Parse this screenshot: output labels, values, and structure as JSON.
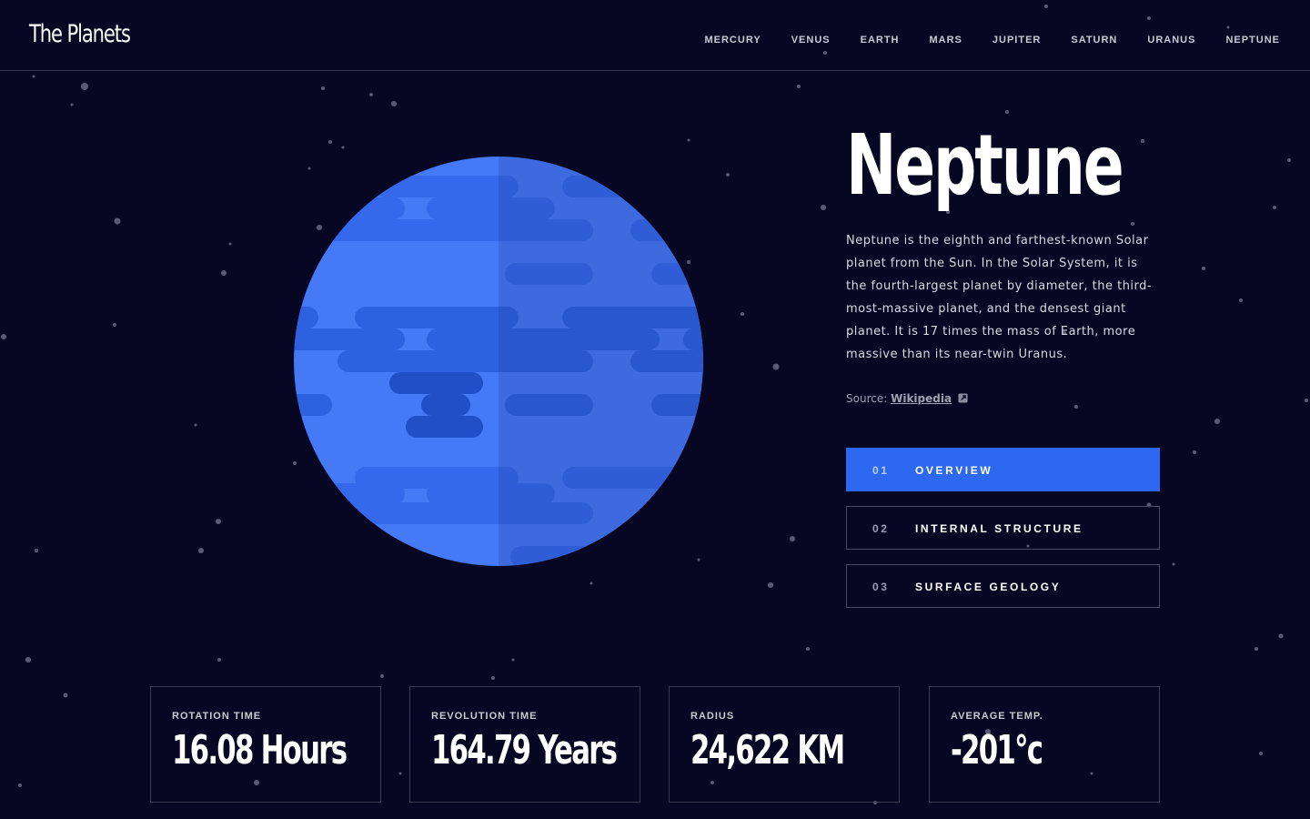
{
  "header": {
    "logo": "The Planets",
    "nav": [
      "MERCURY",
      "VENUS",
      "EARTH",
      "MARS",
      "JUPITER",
      "SATURN",
      "URANUS",
      "NEPTUNE"
    ]
  },
  "planet": {
    "name": "Neptune",
    "description": "Neptune is the eighth and farthest-known Solar planet from the Sun. In the Solar System, it is the fourth-largest planet by diameter, the third-most-massive planet, and the densest giant planet. It is 17 times the mass of Earth, more massive than its near-twin Uranus.",
    "source_label": "Source:",
    "source_link": "Wikipedia",
    "image_icon": "neptune-planet-illustration"
  },
  "tabs": [
    {
      "num": "01",
      "label": "OVERVIEW",
      "active": true
    },
    {
      "num": "02",
      "label": "INTERNAL STRUCTURE",
      "active": false
    },
    {
      "num": "03",
      "label": "SURFACE GEOLOGY",
      "active": false
    }
  ],
  "stats": [
    {
      "label": "ROTATION TIME",
      "value": "16.08 Hours"
    },
    {
      "label": "REVOLUTION TIME",
      "value": "164.79 Years"
    },
    {
      "label": "RADIUS",
      "value": "24,622 KM"
    },
    {
      "label": "AVERAGE TEMP.",
      "value": "-201°c"
    }
  ],
  "colors": {
    "background": "#070724",
    "accent": "#2d68f0",
    "planet_base": "#4579f5",
    "planet_band": "#2e61e0",
    "border": "#38384f"
  },
  "icons": {
    "external_link": "external-link-icon"
  }
}
